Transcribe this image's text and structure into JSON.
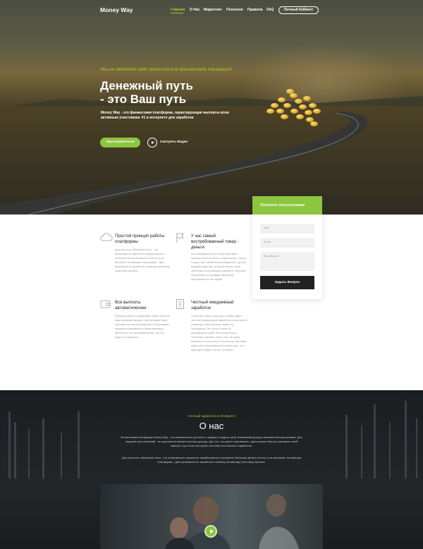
{
  "header": {
    "logo": "Money Way",
    "nav": [
      "Главная",
      "О Нас",
      "Маркетинг",
      "Полезное",
      "Правила",
      "FAQ"
    ],
    "cabinet_button": "Личный Кабинет"
  },
  "hero": {
    "kicker": "Мы не являемся хайп проектом или финансовой пирамидой",
    "title_line1": "Денежный путь",
    "title_line2": "- это Ваш путь",
    "description": "Money Way - это финансовая платформа, гарантирующая выплаты всем активным участникам. #1 в интернете для заработка",
    "join_button": "Присоединиться",
    "watch_label": "Смотреть Видео"
  },
  "features": [
    {
      "icon": "cloud-icon",
      "title": "Простой принцип работы платформы",
      "text": "Для простого обывателя сети - это возможность научиться зарабатывать в интернете большие деньги честно и на автомате. Концепция платформы - дать возможность заработать любому активному участнику проекта."
    },
    {
      "icon": "flag-icon",
      "title": "У нас самый востребованный товар - деньги",
      "text": "На платформе Money Way действует принцип игры (сетевого маркетинга), только товар у нас самый востребованный - деньги. Каждый участник, который вносит свою абонплату за активацию аккаунта, получает отчисления за продажи аккаунтов приглашённых им людей"
    },
    {
      "icon": "wallet-icon",
      "title": "Все выплаты автоматические",
      "text": "Принцип работы платформы очень простой. Ваш активный аккаунт, обеспечивает Вам партнёрское вознаграждение за активацию аккаунта приведённого Вами партнёра. Выплаты у нас автоматические, так что ждать не придётся."
    },
    {
      "icon": "document-icon",
      "title": "Честный ежедневный заработок",
      "text": "Постройте свою структуру и к Вам будет честный ежедневный заработок в интернете! Например, ваш партнёр зашёл на платформу. Тот честно через 30 календарных дней, ему снова нужно пополнить аккаунт, и вы в этот же день получите отчисления. А поскольку партнёры будут регистрироваться в разные дни, то и приходить будут так же, в разные."
    }
  ],
  "consult_form": {
    "title": "Получить консультацию",
    "name_placeholder": "Имя",
    "email_placeholder": "Email",
    "question_placeholder": "Ваш Вопрос",
    "submit": "Задать Вопрос"
  },
  "about": {
    "kicker": "Честный заработок в Интернете",
    "title": "О нас",
    "paragraph1": "Финансовая платформа Money Way - это возможность для всех и каждого создать свой, пассивный доход в автоматическом режиме. Для лидеров или компаний - это дополнительный источник дохода. Для тех, кто умеет приглашать, здесь можно быстро умножить свой капитал, при этом построить источник постоянного заработка.",
    "paragraph2": "Для простого обывателя сети - это возможность научиться зарабатывать в интернете большие деньги честно и на автомате. Концепция платформы - дать возможность заработать любому активному участнику проекта."
  },
  "colors": {
    "accent": "#8cc63f",
    "dark": "#222222",
    "about_bg": "#1f2225"
  }
}
